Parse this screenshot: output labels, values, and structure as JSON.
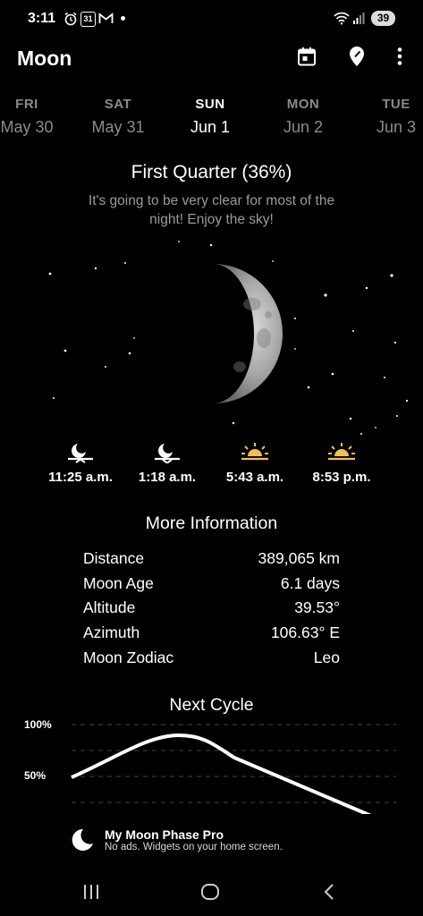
{
  "status_bar": {
    "time": "3:11",
    "calendar_badge": "31",
    "battery": "39",
    "icons": [
      "alarm-icon",
      "calendar-icon",
      "gmail-icon",
      "dot-icon",
      "wifi-icon",
      "signal-icon",
      "battery-icon"
    ]
  },
  "app_bar": {
    "title": "Moon",
    "actions": [
      "calendar-icon",
      "location-pin-icon",
      "more-vert-icon"
    ]
  },
  "days": [
    {
      "dow": "FRI",
      "date": "May 30"
    },
    {
      "dow": "SAT",
      "date": "May 31"
    },
    {
      "dow": "SUN",
      "date": "Jun 1",
      "selected": true
    },
    {
      "dow": "MON",
      "date": "Jun 2"
    },
    {
      "dow": "TUE",
      "date": "Jun 3"
    }
  ],
  "phase": {
    "title": "First Quarter (36%)",
    "description": "It's going to be very clear for most of the night! Enjoy the sky!"
  },
  "times": [
    {
      "icon": "moonrise-icon",
      "time": "11:25 a.m."
    },
    {
      "icon": "moonset-icon",
      "time": "1:18 a.m."
    },
    {
      "icon": "sunrise-icon",
      "time": "5:43 a.m."
    },
    {
      "icon": "sunset-icon",
      "time": "8:53 p.m."
    }
  ],
  "more_information": {
    "title": "More Information",
    "rows": [
      {
        "label": "Distance",
        "value": "389,065 km"
      },
      {
        "label": "Moon Age",
        "value": "6.1 days"
      },
      {
        "label": "Altitude",
        "value": "39.53°"
      },
      {
        "label": "Azimuth",
        "value": "106.63° E"
      },
      {
        "label": "Moon Zodiac",
        "value": "Leo"
      }
    ]
  },
  "next_cycle": {
    "title": "Next Cycle",
    "y_ticks": [
      "100%",
      "50%"
    ]
  },
  "promo": {
    "title": "My Moon Phase Pro",
    "subtitle": "No ads. Widgets on your home screen."
  },
  "nav_bar": [
    "recents-button",
    "home-button",
    "back-button"
  ]
}
